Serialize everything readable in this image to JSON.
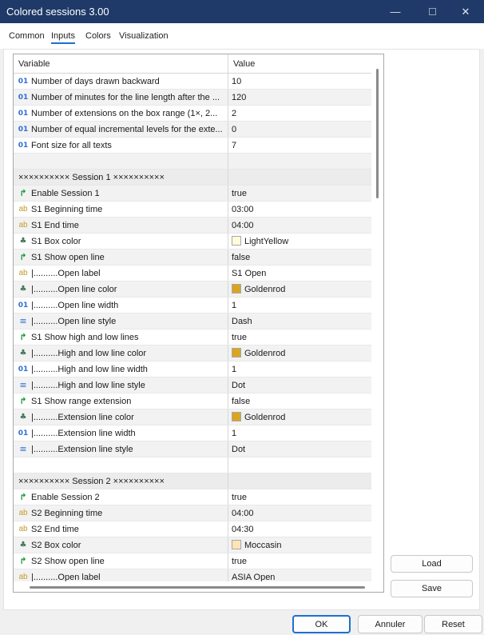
{
  "window": {
    "title": "Colored sessions 3.00",
    "minimize_glyph": "—",
    "close_glyph": "✕"
  },
  "tabs": [
    {
      "label": "Common"
    },
    {
      "label": "Inputs"
    },
    {
      "label": "Colors"
    },
    {
      "label": "Visualization"
    }
  ],
  "grid": {
    "headers": {
      "variable": "Variable",
      "value": "Value"
    },
    "icons": {
      "num": "01",
      "ab": "ab",
      "bool": "↱",
      "color": "♣",
      "style": "≡"
    },
    "rows": [
      {
        "icon": "num-icon",
        "label": "Number of days drawn backward",
        "value": "10"
      },
      {
        "icon": "num-icon",
        "label": "Number of minutes for the line length after the ...",
        "value": "120"
      },
      {
        "icon": "num-icon",
        "label": "Number of extensions on the box range (1×, 2...",
        "value": "2"
      },
      {
        "icon": "num-icon",
        "label": "Number of equal incremental levels for the exte...",
        "value": "0"
      },
      {
        "icon": "num-icon",
        "label": "Font size for all texts",
        "value": "7"
      },
      {
        "icon": "",
        "label": "",
        "value": ""
      },
      {
        "icon": "",
        "label": "××××××××××  Session 1  ××××××××××",
        "value": "",
        "section": true
      },
      {
        "icon": "bool-icon",
        "label": "Enable Session 1",
        "value": "true"
      },
      {
        "icon": "ab-icon",
        "label": "S1  Beginning time",
        "value": "03:00"
      },
      {
        "icon": "ab-icon",
        "label": "S1  End time",
        "value": "04:00"
      },
      {
        "icon": "color-icon",
        "label": "S1  Box color",
        "value": "LightYellow",
        "swatch": "#fffbd8"
      },
      {
        "icon": "bool-icon",
        "label": "S1  Show open line",
        "value": "false"
      },
      {
        "icon": "ab-icon",
        "label": "|..........Open label",
        "value": "S1 Open"
      },
      {
        "icon": "color-icon",
        "label": "|..........Open line color",
        "value": "Goldenrod",
        "swatch": "#daa520"
      },
      {
        "icon": "num-icon",
        "label": "|..........Open line width",
        "value": "1"
      },
      {
        "icon": "style-icon",
        "label": "|..........Open line style",
        "value": "Dash"
      },
      {
        "icon": "bool-icon",
        "label": "S1  Show high and low lines",
        "value": "true"
      },
      {
        "icon": "color-icon",
        "label": "|..........High and low line color",
        "value": "Goldenrod",
        "swatch": "#daa520"
      },
      {
        "icon": "num-icon",
        "label": "|..........High and low line width",
        "value": "1"
      },
      {
        "icon": "style-icon",
        "label": "|..........High and low line style",
        "value": "Dot"
      },
      {
        "icon": "bool-icon",
        "label": "S1  Show range extension",
        "value": "false"
      },
      {
        "icon": "color-icon",
        "label": "|..........Extension line color",
        "value": "Goldenrod",
        "swatch": "#daa520"
      },
      {
        "icon": "num-icon",
        "label": "|..........Extension line width",
        "value": "1"
      },
      {
        "icon": "style-icon",
        "label": "|..........Extension line style",
        "value": "Dot"
      },
      {
        "icon": "",
        "label": "",
        "value": ""
      },
      {
        "icon": "",
        "label": "××××××××××  Session 2  ××××××××××",
        "value": "",
        "section": true
      },
      {
        "icon": "bool-icon",
        "label": "Enable Session 2",
        "value": "true"
      },
      {
        "icon": "ab-icon",
        "label": "S2  Beginning time",
        "value": "04:00"
      },
      {
        "icon": "ab-icon",
        "label": "S2  End time",
        "value": "04:30"
      },
      {
        "icon": "color-icon",
        "label": "S2  Box color",
        "value": "Moccasin",
        "swatch": "#ffe4b5"
      },
      {
        "icon": "bool-icon",
        "label": "S2  Show open line",
        "value": "true"
      },
      {
        "icon": "ab-icon",
        "label": "|..........Open label",
        "value": "ASIA Open"
      }
    ]
  },
  "side_buttons": {
    "load": "Load",
    "save": "Save"
  },
  "footer_buttons": {
    "ok": "OK",
    "cancel": "Annuler",
    "reset": "Reset"
  }
}
